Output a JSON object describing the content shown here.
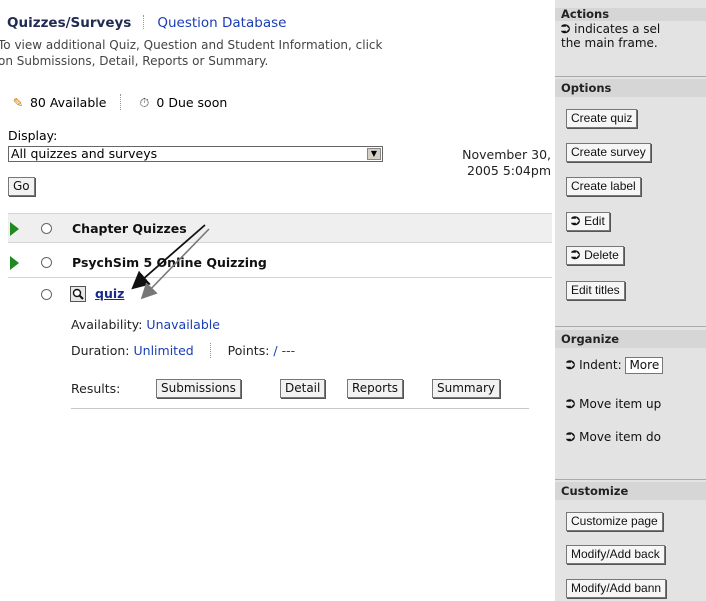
{
  "header": {
    "title": "Quizzes/Surveys",
    "question_database": "Question Database",
    "intro_line1": "To view additional Quiz, Question and Student Information, click",
    "intro_line2": "on Submissions, Detail, Reports or Summary."
  },
  "stats": {
    "available": "80 Available",
    "due_soon": "0 Due soon"
  },
  "display": {
    "label": "Display:",
    "selected": "All quizzes and surveys",
    "go": "Go",
    "date_line1": "November 30,",
    "date_line2": "2005 5:04pm"
  },
  "items": [
    {
      "label": "Chapter Quizzes"
    },
    {
      "label": "PsychSim 5 Online Quizzing"
    }
  ],
  "quiz": {
    "link": "quiz",
    "availability_label": "Availability:",
    "availability_value": "Unavailable",
    "duration_label": "Duration:",
    "duration_value": "Unlimited",
    "points_label": "Points:",
    "points_value": "/ ---",
    "results_label": "Results:",
    "results_buttons": [
      "Submissions",
      "Detail",
      "Reports",
      "Summary"
    ]
  },
  "panel": {
    "actions_title": "Actions",
    "actions_line1": "indicates a sel",
    "actions_line2": "the main frame.",
    "options_title": "Options",
    "options": [
      "Create quiz",
      "Create survey",
      "Create label",
      "Edit",
      "Delete",
      "Edit titles"
    ],
    "organize_title": "Organize",
    "indent_label": "Indent:",
    "indent_value": "More",
    "move_up": "Move item up",
    "move_down": "Move item do",
    "customize_title": "Customize",
    "customize": [
      "Customize page",
      "Modify/Add back",
      "Modify/Add bann"
    ]
  },
  "colors": {
    "link_blue": "#1a3db4",
    "title_navy": "#1f2b52",
    "expand_green": "#1f8a1f",
    "panel_gray": "#e3e3e3"
  }
}
